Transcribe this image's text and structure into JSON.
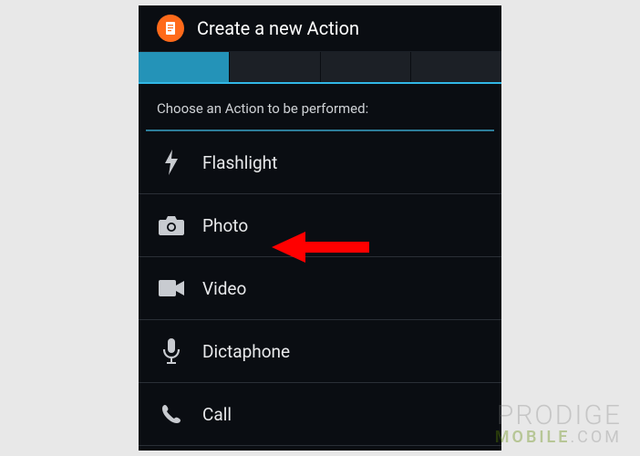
{
  "header": {
    "title": "Create a new Action",
    "icon": "document-icon"
  },
  "tabs": {
    "count": 4,
    "active_index": 0
  },
  "instruction": "Choose an Action to be performed:",
  "actions": [
    {
      "icon": "flash-icon",
      "label": "Flashlight"
    },
    {
      "icon": "camera-icon",
      "label": "Photo"
    },
    {
      "icon": "video-icon",
      "label": "Video"
    },
    {
      "icon": "mic-icon",
      "label": "Dictaphone"
    },
    {
      "icon": "phone-icon",
      "label": "Call"
    }
  ],
  "annotation": {
    "arrow_target": "Photo",
    "arrow_color": "#ff0000"
  },
  "watermark": {
    "line1": "PRODIGE",
    "line2_a": "MOBILE",
    "line2_b": ".COM"
  }
}
